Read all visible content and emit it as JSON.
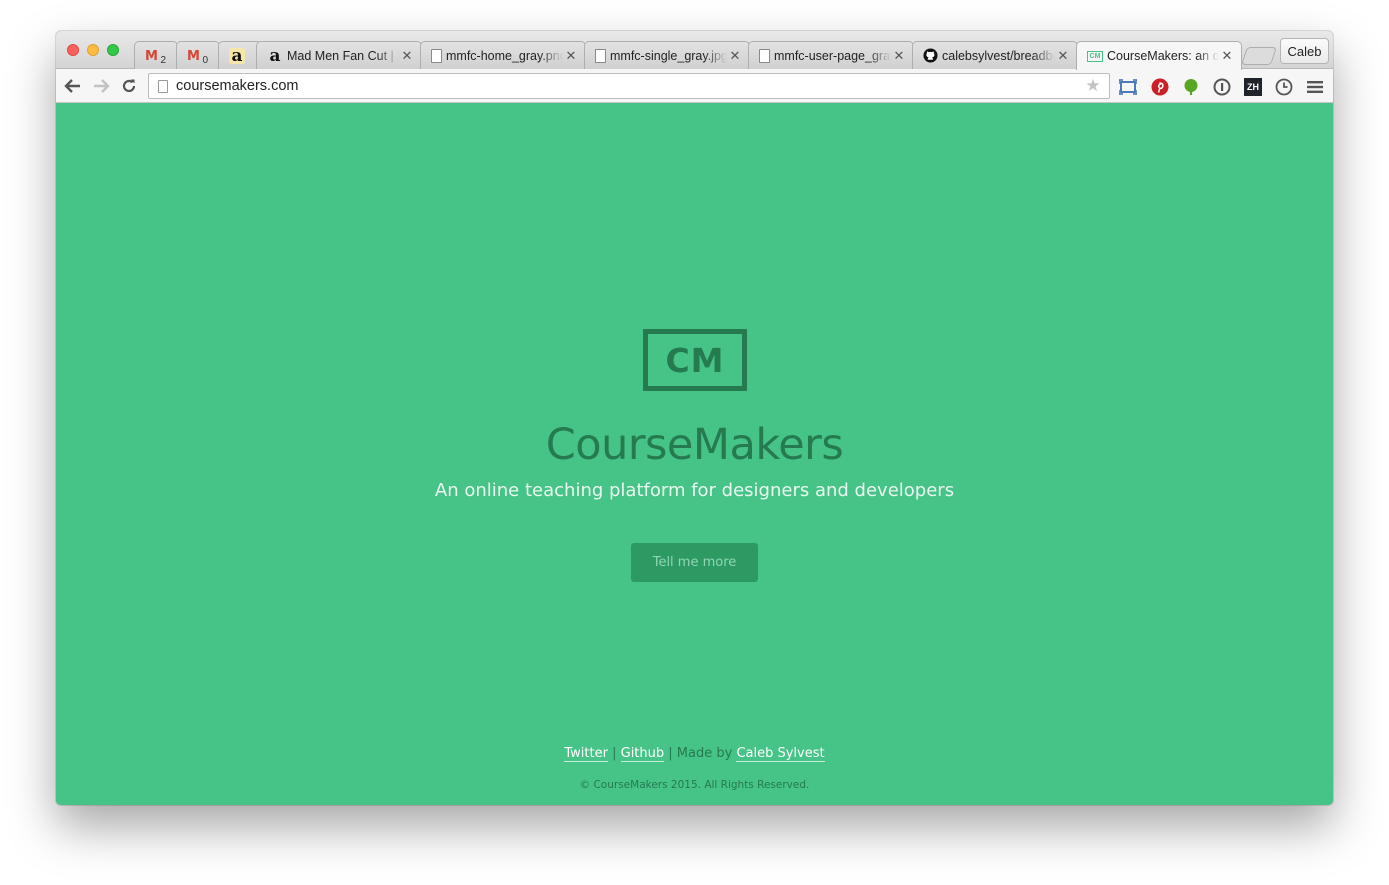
{
  "browser": {
    "tabs": [
      {
        "icon": "gmail-icon",
        "title": "",
        "badge": "2"
      },
      {
        "icon": "gmail-icon",
        "title": "",
        "badge": "0"
      },
      {
        "icon": "amazon-icon",
        "title": ""
      },
      {
        "icon": "amazon-icon",
        "title": "Mad Men Fan Cut | U"
      },
      {
        "icon": "document-icon",
        "title": "mmfc-home_gray.png"
      },
      {
        "icon": "document-icon",
        "title": "mmfc-single_gray.jpg"
      },
      {
        "icon": "document-icon",
        "title": "mmfc-user-page_gray"
      },
      {
        "icon": "github-icon",
        "title": "calebsylvest/breadbo"
      },
      {
        "icon": "coursemakers-icon",
        "title": "CourseMakers: an on"
      }
    ],
    "profile_name": "Caleb",
    "url": "coursemakers.com",
    "colors": {
      "page_bg": "#46c387",
      "accent_dark": "#257a50",
      "button_bg": "#2d9a64"
    }
  },
  "page": {
    "logo_text": "CM",
    "brand_name": "CourseMakers",
    "tagline": "An online teaching platform for designers and developers",
    "cta_label": "Tell me more",
    "footer": {
      "twitter": "Twitter",
      "sep1": "|",
      "github": "Github",
      "sep2": "| Made by",
      "author": "Caleb Sylvest",
      "copyright": "© CourseMakers 2015. All Rights Reserved."
    }
  }
}
